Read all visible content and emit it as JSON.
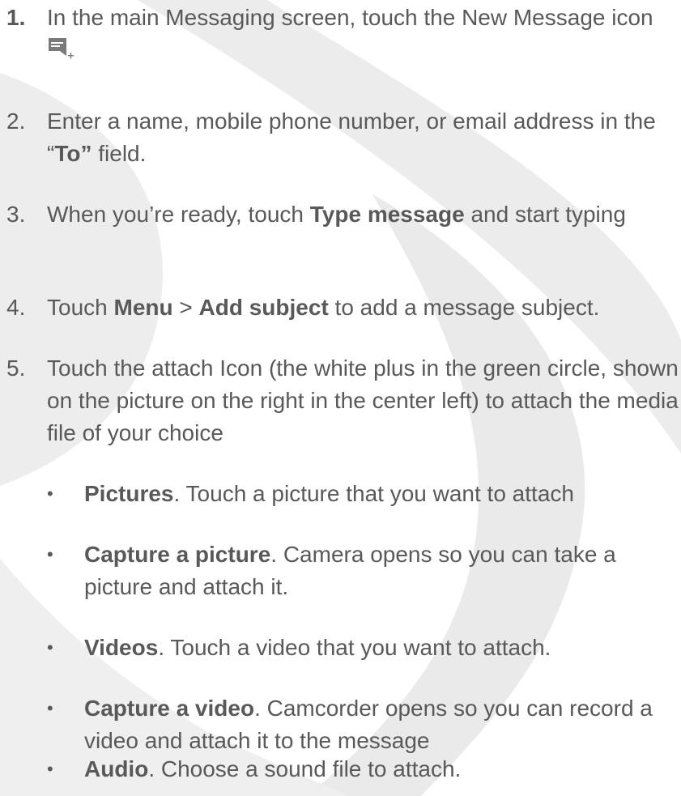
{
  "steps": [
    {
      "number": "1.",
      "text": "In the main Messaging screen, touch the New Message icon",
      "icon": "new-message-icon"
    },
    {
      "number": "2.",
      "parts": [
        "Enter a name, mobile phone number, or email address in the “",
        "To”",
        " field."
      ]
    },
    {
      "number": "3.",
      "parts": [
        "When you’re ready, touch ",
        "Type message",
        " and start typing"
      ]
    },
    {
      "number": "4.",
      "parts": [
        "Touch ",
        "Menu",
        " > ",
        "Add subject",
        " to add a message subject."
      ]
    },
    {
      "number": "5.",
      "text": "Touch the attach Icon (the white plus in the green circle, shown on the picture on the right in the center left) to attach the media file of your choice"
    }
  ],
  "options": [
    {
      "term": "Pictures",
      "desc": ". Touch a picture that you want to attach"
    },
    {
      "term": "Capture a picture",
      "desc": ".  Camera opens so you can take a picture and attach it."
    },
    {
      "term": "Videos",
      "desc": ". Touch a video that you want to attach."
    },
    {
      "term": "Capture a video",
      "desc": ". Camcorder opens so you can record a video and attach it to the message"
    },
    {
      "term": "Audio",
      "desc": ". Choose a sound file to attach."
    }
  ],
  "bullet_char": "•",
  "colors": {
    "text": "#595959",
    "watermark": "#e9e9e9",
    "icon": "#7a7a7a"
  }
}
